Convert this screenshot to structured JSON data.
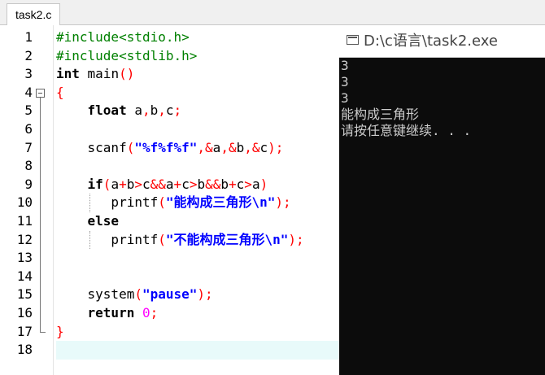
{
  "editor": {
    "tab_label": "task2.c",
    "line_numbers": [
      "1",
      "2",
      "3",
      "4",
      "5",
      "6",
      "7",
      "8",
      "9",
      "10",
      "11",
      "12",
      "13",
      "14",
      "15",
      "16",
      "17",
      "18"
    ],
    "lines": [
      [
        {
          "t": "#include<stdio.h>",
          "c": "pp"
        }
      ],
      [
        {
          "t": "#include<stdlib.h>",
          "c": "pp"
        }
      ],
      [
        {
          "t": "int",
          "c": "kw"
        },
        {
          "t": " main"
        },
        {
          "t": "()",
          "c": "op"
        }
      ],
      [
        {
          "t": "{",
          "c": "op"
        }
      ],
      [
        {
          "t": "    "
        },
        {
          "t": "float",
          "c": "kw"
        },
        {
          "t": " a"
        },
        {
          "t": ",",
          "c": "op"
        },
        {
          "t": "b"
        },
        {
          "t": ",",
          "c": "op"
        },
        {
          "t": "c"
        },
        {
          "t": ";",
          "c": "op"
        }
      ],
      [],
      [
        {
          "t": "    scanf"
        },
        {
          "t": "(",
          "c": "op"
        },
        {
          "t": "\"%f%f%f\"",
          "c": "str"
        },
        {
          "t": ",&",
          "c": "op"
        },
        {
          "t": "a"
        },
        {
          "t": ",&",
          "c": "op"
        },
        {
          "t": "b"
        },
        {
          "t": ",&",
          "c": "op"
        },
        {
          "t": "c"
        },
        {
          "t": ");",
          "c": "op"
        }
      ],
      [],
      [
        {
          "t": "    "
        },
        {
          "t": "if",
          "c": "kw"
        },
        {
          "t": "(",
          "c": "op"
        },
        {
          "t": "a"
        },
        {
          "t": "+",
          "c": "op"
        },
        {
          "t": "b"
        },
        {
          "t": ">",
          "c": "op"
        },
        {
          "t": "c"
        },
        {
          "t": "&&",
          "c": "op"
        },
        {
          "t": "a"
        },
        {
          "t": "+",
          "c": "op"
        },
        {
          "t": "c"
        },
        {
          "t": ">",
          "c": "op"
        },
        {
          "t": "b"
        },
        {
          "t": "&&",
          "c": "op"
        },
        {
          "t": "b"
        },
        {
          "t": "+",
          "c": "op"
        },
        {
          "t": "c"
        },
        {
          "t": ">",
          "c": "op"
        },
        {
          "t": "a"
        },
        {
          "t": ")",
          "c": "op"
        }
      ],
      [
        {
          "t": "       printf"
        },
        {
          "t": "(",
          "c": "op"
        },
        {
          "t": "\"能构成三角形\\n\"",
          "c": "str"
        },
        {
          "t": ");",
          "c": "op"
        }
      ],
      [
        {
          "t": "    "
        },
        {
          "t": "else",
          "c": "kw"
        }
      ],
      [
        {
          "t": "       printf"
        },
        {
          "t": "(",
          "c": "op"
        },
        {
          "t": "\"不能构成三角形\\n\"",
          "c": "str"
        },
        {
          "t": ");",
          "c": "op"
        }
      ],
      [],
      [],
      [
        {
          "t": "    system"
        },
        {
          "t": "(",
          "c": "op"
        },
        {
          "t": "\"pause\"",
          "c": "str"
        },
        {
          "t": ");",
          "c": "op"
        }
      ],
      [
        {
          "t": "    "
        },
        {
          "t": "return",
          "c": "kw"
        },
        {
          "t": " "
        },
        {
          "t": "0",
          "c": "num"
        },
        {
          "t": ";",
          "c": "op"
        }
      ],
      [
        {
          "t": "}",
          "c": "op"
        }
      ],
      []
    ],
    "current_line": 18
  },
  "console": {
    "title": "D:\\c语言\\task2.exe",
    "output_lines": [
      "3",
      "3",
      "3",
      "能构成三角形",
      "请按任意键继续. . ."
    ]
  },
  "colors": {
    "preprocessor": "#008000",
    "keyword": "#000000",
    "string": "#0000ff",
    "operator": "#ff0000",
    "number": "#ff00ff",
    "current_line_bg": "#e8fafa",
    "console_bg": "#0c0c0c",
    "console_text": "#cccccc"
  },
  "icons": {
    "fold_toggle": "minus-box-icon",
    "console_window": "console-window-icon"
  }
}
